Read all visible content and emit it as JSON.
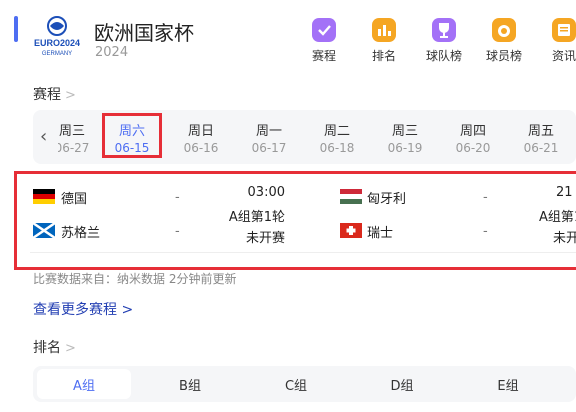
{
  "header": {
    "logo_text": "EURO2024",
    "logo_subtext": "GERMANY",
    "title": "欧洲国家杯",
    "year": "2024"
  },
  "nav": [
    {
      "label": "赛程",
      "icon": "calendar-check-icon",
      "color": "#a371f7"
    },
    {
      "label": "排名",
      "icon": "bar-chart-icon",
      "color": "#f5a623"
    },
    {
      "label": "球队榜",
      "icon": "trophy-icon",
      "color": "#a371f7"
    },
    {
      "label": "球员榜",
      "icon": "medal-icon",
      "color": "#f5a623"
    },
    {
      "label": "资讯",
      "icon": "news-icon",
      "color": "#f5a623"
    }
  ],
  "schedule": {
    "section_label": "赛程",
    "days": [
      {
        "week": "周三",
        "date": "06-27"
      },
      {
        "week": "周六",
        "date": "06-15",
        "selected": true
      },
      {
        "week": "周日",
        "date": "06-16"
      },
      {
        "week": "周一",
        "date": "06-17"
      },
      {
        "week": "周二",
        "date": "06-18"
      },
      {
        "week": "周三",
        "date": "06-19"
      },
      {
        "week": "周四",
        "date": "06-20"
      },
      {
        "week": "周五",
        "date": "06-21"
      }
    ],
    "matches": [
      {
        "home": {
          "name": "德国",
          "flag": "germany-flag-icon"
        },
        "away": {
          "name": "苏格兰",
          "flag": "scotland-flag-icon"
        },
        "home_score": "-",
        "away_score": "-",
        "time": "03:00",
        "group_round": "A组第1轮",
        "status": "未开赛"
      },
      {
        "home": {
          "name": "匈牙利",
          "flag": "hungary-flag-icon"
        },
        "away": {
          "name": "瑞士",
          "flag": "switzerland-flag-icon"
        },
        "home_score": "-",
        "away_score": "-",
        "time": "21",
        "group_round": "A组第1",
        "status": "未开"
      }
    ],
    "source_text": "比赛数据来自：纳米数据 2分钟前更新",
    "more_link": "查看更多赛程 >"
  },
  "ranking": {
    "section_label": "排名",
    "tabs": [
      "A组",
      "B组",
      "C组",
      "D组",
      "E组"
    ],
    "active_tab": "A组"
  },
  "colors": {
    "accent": "#4e6ef2",
    "highlight_red": "#e62e37",
    "link": "#2440b3"
  }
}
